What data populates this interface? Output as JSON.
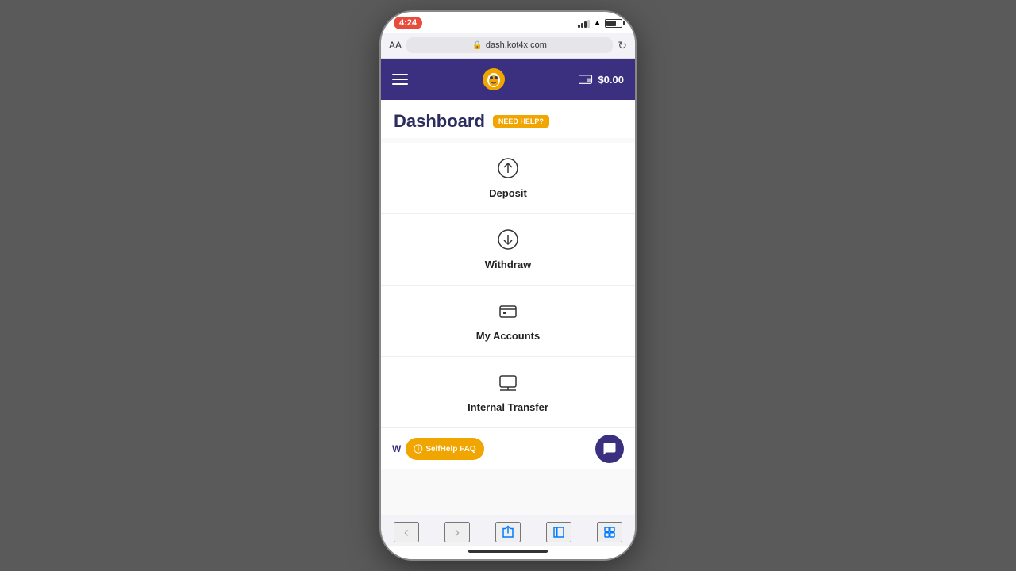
{
  "status": {
    "time": "4:24",
    "url": "dash.kot4x.com"
  },
  "browser": {
    "aa_label": "AA",
    "url": "dash.kot4x.com",
    "lock_symbol": "🔒"
  },
  "nav": {
    "wallet_amount": "$0.00"
  },
  "page": {
    "title": "Dashboard",
    "need_help_label": "NEED HELP?"
  },
  "menu_items": [
    {
      "id": "deposit",
      "label": "Deposit",
      "icon": "upload-circle"
    },
    {
      "id": "withdraw",
      "label": "Withdraw",
      "icon": "download-circle"
    },
    {
      "id": "my-accounts",
      "label": "My Accounts",
      "icon": "briefcase"
    },
    {
      "id": "internal-transfer",
      "label": "Internal Transfer",
      "icon": "transfer"
    }
  ],
  "bottom": {
    "self_help_label": "SelfHelp FAQ",
    "partial_text": "W"
  },
  "colors": {
    "nav_bg": "#3b3080",
    "accent": "#f0a500",
    "title_color": "#2c2c5e"
  }
}
